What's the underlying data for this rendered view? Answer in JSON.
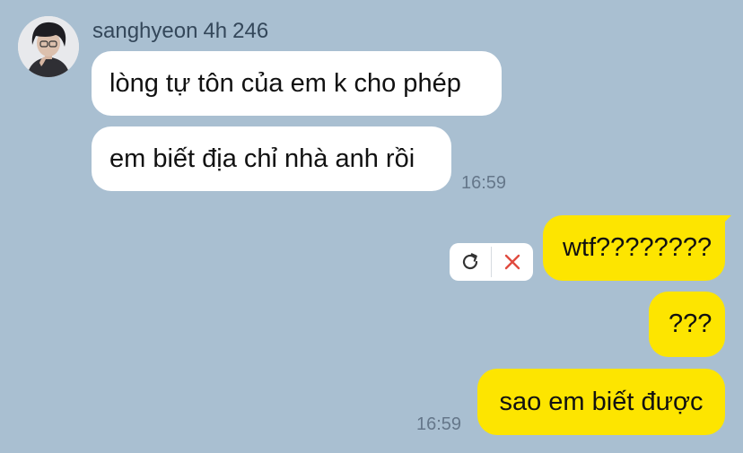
{
  "chat": {
    "sender": {
      "name": "sanghyeon",
      "last_seen": "4h",
      "count": "246",
      "avatar_icon": "profile-photo"
    },
    "incoming_messages": [
      {
        "text": "lòng tự tôn của em k cho phép"
      },
      {
        "text": "em biết địa chỉ nhà anh rồi",
        "time": "16:59"
      }
    ],
    "outgoing_messages": [
      {
        "text": "wtf????????",
        "status": "failed"
      },
      {
        "text": "???"
      },
      {
        "text": "sao em biết được",
        "time": "16:59"
      }
    ],
    "failed_actions": {
      "retry_icon": "refresh-icon",
      "delete_icon": "close-icon"
    }
  },
  "colors": {
    "background": "#a9bfd1",
    "incoming_bubble": "#ffffff",
    "outgoing_bubble": "#fde500",
    "sender_text": "#34475a",
    "timestamp_text": "#65778a",
    "delete_icon": "#e04b3f"
  }
}
